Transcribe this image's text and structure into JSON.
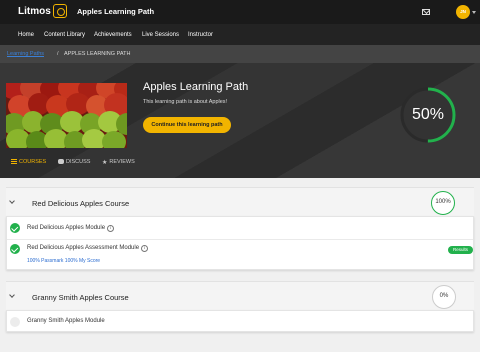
{
  "header": {
    "brand": "Litmos",
    "title": "Apples Learning Path",
    "avatar_initials": "JN"
  },
  "nav": {
    "items": [
      "Home",
      "Content Library",
      "Achievements",
      "Live Sessions",
      "Instructor"
    ]
  },
  "breadcrumb": {
    "link": "Learning Paths",
    "separator": "/",
    "current": "APPLES LEARNING PATH"
  },
  "hero": {
    "title": "Apples Learning Path",
    "description": "This learning path is about Apples!",
    "continue_label": "Continue this learning path",
    "progress_label": "50%",
    "progress_fraction": 0.5
  },
  "tabs": {
    "courses": "COURSES",
    "discuss": "DISCUSS",
    "reviews": "REVIEWS"
  },
  "courses": [
    {
      "title": "Red Delicious Apples Course",
      "progress_label": "100%",
      "progress_fraction": 1.0,
      "modules": [
        {
          "title": "Red Delicious Apples Module",
          "info": "i",
          "completed": true
        },
        {
          "title": "Red Delicious Apples Assessment Module",
          "info": "i",
          "completed": true,
          "score_text": "100% Passmark 100% My Score",
          "badge": "Results"
        }
      ]
    },
    {
      "title": "Granny Smith Apples Course",
      "progress_label": "0%",
      "progress_fraction": 0.0,
      "modules": [
        {
          "title": "Granny Smith Apples Module",
          "completed": false
        }
      ]
    }
  ],
  "colors": {
    "accent": "#f2b400",
    "success": "#22b14c",
    "link": "#2b6cd0",
    "topbar": "#1a1a1a"
  }
}
